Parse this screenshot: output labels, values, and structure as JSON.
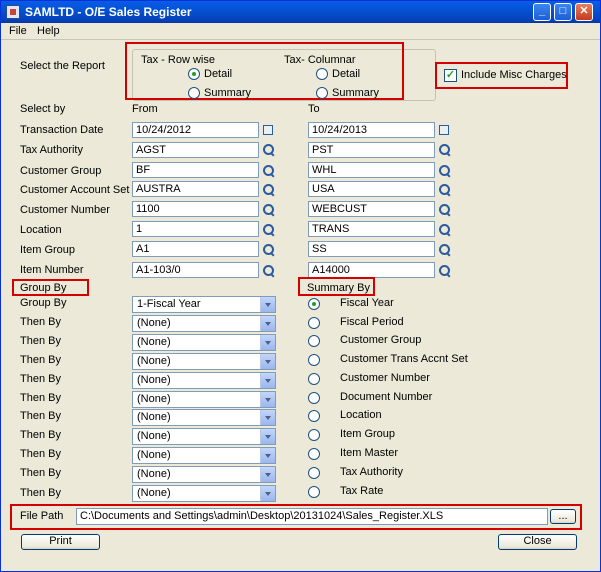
{
  "window": {
    "title": "SAMLTD - O/E Sales Register"
  },
  "menu": {
    "file": "File",
    "help": "Help"
  },
  "report": {
    "label": "Select the Report",
    "tax_rowwise": "Tax - Row wise",
    "tax_columnar": "Tax- Columnar",
    "detail": "Detail",
    "summary": "Summary",
    "include_misc": "Include Misc Charges"
  },
  "ranges": {
    "select_by": "Select by",
    "from": "From",
    "to": "To",
    "rows": [
      {
        "label": "Transaction Date",
        "from": "10/24/2012",
        "to": "10/24/2013"
      },
      {
        "label": "Tax Authority",
        "from": "AGST",
        "to": "PST"
      },
      {
        "label": "Customer Group",
        "from": "BF",
        "to": "WHL"
      },
      {
        "label": "Customer Account Set",
        "from": "AUSTRA",
        "to": "USA"
      },
      {
        "label": "Customer Number",
        "from": "1100",
        "to": "WEBCUST"
      },
      {
        "label": "Location",
        "from": "1",
        "to": "TRANS"
      },
      {
        "label": "Item Group",
        "from": "A1",
        "to": "SS"
      },
      {
        "label": "Item Number",
        "from": "A1-103/0",
        "to": "A14000"
      }
    ]
  },
  "group_by": {
    "header": "Group By",
    "rows": [
      {
        "label": "Group By",
        "value": "1-Fiscal Year"
      },
      {
        "label": "Then By",
        "value": "(None)"
      },
      {
        "label": "Then By",
        "value": "(None)"
      },
      {
        "label": "Then By",
        "value": "(None)"
      },
      {
        "label": "Then By",
        "value": "(None)"
      },
      {
        "label": "Then By",
        "value": "(None)"
      },
      {
        "label": "Then By",
        "value": "(None)"
      },
      {
        "label": "Then By",
        "value": "(None)"
      },
      {
        "label": "Then By",
        "value": "(None)"
      },
      {
        "label": "Then By",
        "value": "(None)"
      },
      {
        "label": "Then By",
        "value": "(None)"
      }
    ]
  },
  "summary_by": {
    "header": "Summary By",
    "options": [
      "Fiscal Year",
      "Fiscal Period",
      "Customer Group",
      "Customer Trans Accnt Set",
      "Customer Number",
      "Document Number",
      "Location",
      "Item Group",
      "Item Master",
      "Tax Authority",
      "Tax Rate"
    ]
  },
  "file_path": {
    "label": "File Path",
    "value": "C:\\Documents and Settings\\admin\\Desktop\\20131024\\Sales_Register.XLS",
    "browse": "..."
  },
  "buttons": {
    "print": "Print",
    "close": "Close"
  }
}
